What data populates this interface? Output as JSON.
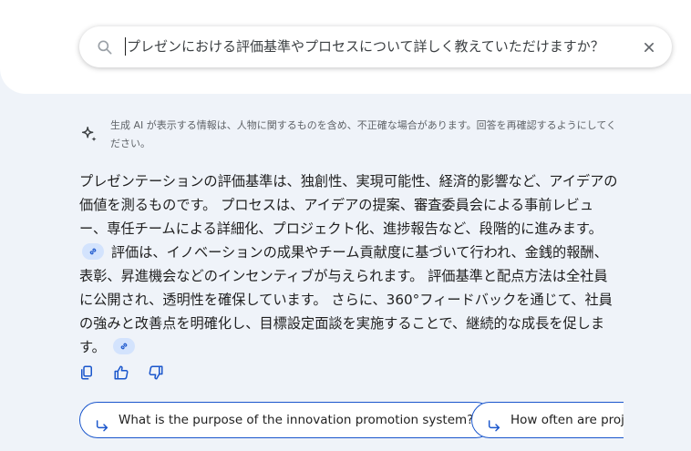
{
  "search": {
    "query": "プレゼンにおける評価基準やプロセスについて詳しく教えていただけますか？"
  },
  "disclaimer": "生成 AI が表示する情報は、人物に関するものを含め、不正確な場合があります。回答を再確認するようにしてください。",
  "answer": {
    "part1": "プレゼンテーションの評価基準は、独創性、実現可能性、経済的影響など、アイデアの価値を測るものです。 プロセスは、アイデアの提案、審査委員会による事前レビュー、専任チームによる詳細化、プロジェクト化、進捗報告など、段階的に進みます。",
    "part2": "評価は、イノベーションの成果やチーム貢献度に基づいて行われ、金銭的報酬、表彰、昇進機会などのインセンティブが与えられます。 評価基準と配点方法は全社員に公開され、透明性を確保しています。 さらに、360°フィードバックを通じて、社員の強みと改善点を明確化し、目標設定面談を実施することで、継続的な成長を促します。"
  },
  "followups": [
    "What is the purpose of the innovation promotion system?",
    "How often are projec"
  ],
  "colors": {
    "accent": "#1a56cc",
    "link_chip": "#d3e3fd",
    "panel_bg": "#eff3f9"
  }
}
